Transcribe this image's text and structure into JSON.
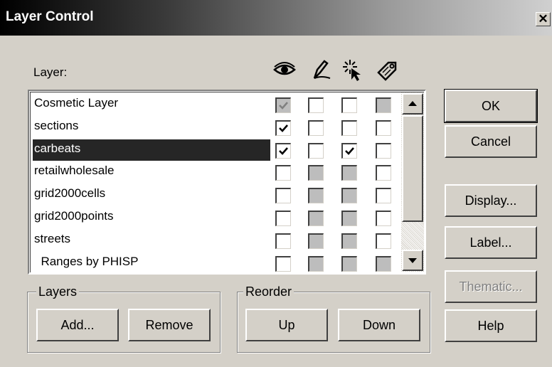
{
  "window": {
    "title": "Layer Control",
    "close_glyph": "✕"
  },
  "header": {
    "layer_label": "Layer:",
    "icons": [
      "visible-eye-icon",
      "editable-pencil-icon",
      "selectable-cursor-icon",
      "autolabel-tag-icon"
    ]
  },
  "layers": [
    {
      "name": "Cosmetic Layer",
      "visible": "checked-disabled",
      "editable": "unchecked",
      "selectable": "unchecked",
      "autolabel": "grey"
    },
    {
      "name": "sections",
      "visible": "checked",
      "editable": "unchecked",
      "selectable": "unchecked",
      "autolabel": "unchecked"
    },
    {
      "name": "carbeats",
      "selected": true,
      "visible": "checked",
      "editable": "unchecked",
      "selectable": "checked",
      "autolabel": "unchecked"
    },
    {
      "name": "retailwholesale",
      "visible": "unchecked",
      "editable": "grey",
      "selectable": "grey",
      "autolabel": "unchecked"
    },
    {
      "name": "grid2000cells",
      "visible": "unchecked",
      "editable": "grey",
      "selectable": "grey",
      "autolabel": "unchecked"
    },
    {
      "name": "grid2000points",
      "visible": "unchecked",
      "editable": "grey",
      "selectable": "grey",
      "autolabel": "unchecked"
    },
    {
      "name": "streets",
      "visible": "unchecked",
      "editable": "grey",
      "selectable": "grey",
      "autolabel": "unchecked"
    },
    {
      "name": "  Ranges by PHISP",
      "visible": "unchecked",
      "editable": "grey",
      "selectable": "grey",
      "autolabel": "grey"
    }
  ],
  "buttons": {
    "ok": "OK",
    "cancel": "Cancel",
    "display": "Display...",
    "label": "Label...",
    "thematic": "Thematic...",
    "help": "Help"
  },
  "layers_group": {
    "title": "Layers",
    "add": "Add...",
    "remove": "Remove"
  },
  "reorder_group": {
    "title": "Reorder",
    "up": "Up",
    "down": "Down"
  },
  "colors": {
    "selection": "#262626",
    "face": "#d4d0c8",
    "disabled_check": "#bdbdbd"
  }
}
